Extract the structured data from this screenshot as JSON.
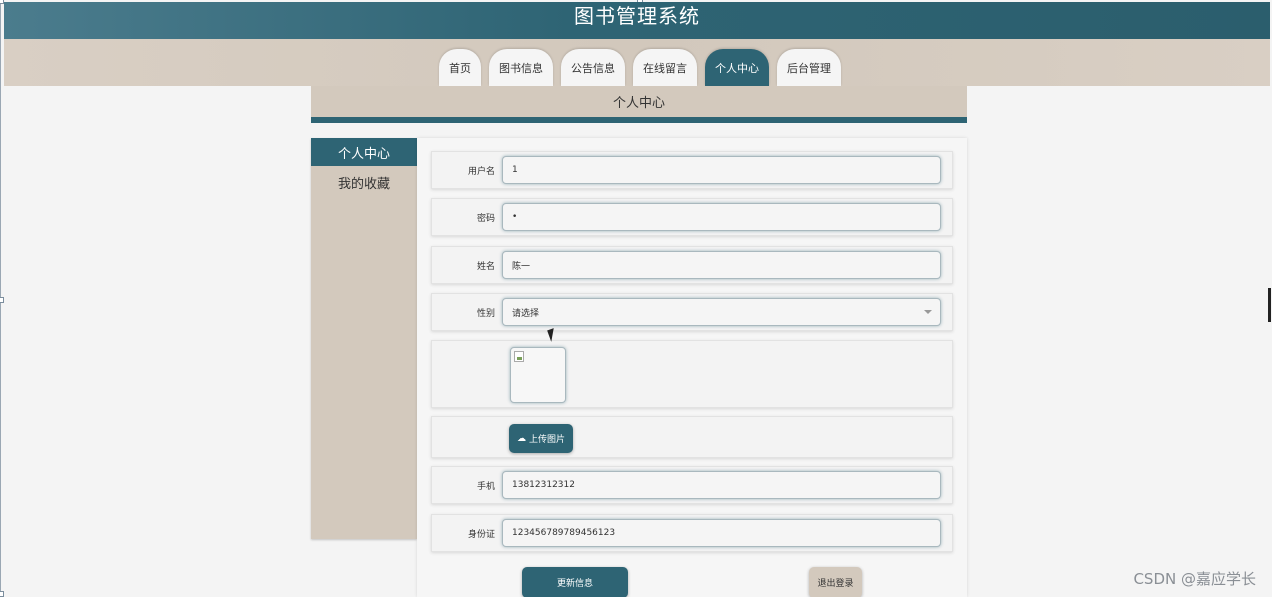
{
  "app": {
    "title": "图书管理系统"
  },
  "nav": {
    "items": [
      {
        "label": "首页",
        "active": false
      },
      {
        "label": "图书信息",
        "active": false
      },
      {
        "label": "公告信息",
        "active": false
      },
      {
        "label": "在线留言",
        "active": false
      },
      {
        "label": "个人中心",
        "active": true
      },
      {
        "label": "后台管理",
        "active": false
      }
    ]
  },
  "page": {
    "heading": "个人中心"
  },
  "sidebar": {
    "items": [
      {
        "label": "个人中心",
        "active": true
      },
      {
        "label": "我的收藏",
        "active": false
      }
    ]
  },
  "form": {
    "username": {
      "label": "用户名",
      "value": "1"
    },
    "password": {
      "label": "密码",
      "value": "•"
    },
    "name": {
      "label": "姓名",
      "value": "陈一"
    },
    "gender": {
      "label": "性别",
      "value": "请选择"
    },
    "upload_label": "上传图片",
    "phone": {
      "label": "手机",
      "value": "13812312312"
    },
    "id_card": {
      "label": "身份证",
      "value": "123456789789456123"
    }
  },
  "actions": {
    "update_label": "更新信息",
    "logout_label": "退出登录"
  },
  "watermark": "CSDN @嘉应学长",
  "colors": {
    "primary": "#2e6474",
    "sand": "#d3c9bd",
    "background": "#f4f4f4"
  }
}
